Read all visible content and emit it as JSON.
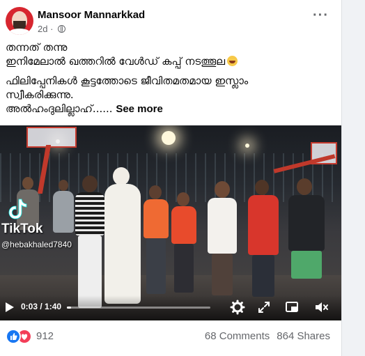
{
  "post": {
    "author": "Mansoor Mannarkkad",
    "time": "2d",
    "privacy_icon": "globe-icon",
    "menu_icon": "more-options-icon",
    "text_lines": [
      "തന്നത് തന്നു",
      "ഇനിമേലാൽ ഖത്തറിൽ വേൾഡ് കപ്പ് നടത്തൂല"
    ],
    "text_lines_2": [
      "ഫിലിപ്പേനികൾ കൂട്ടത്തോടെ ജീവിതമതമായ ഇസ്ലാം",
      "സ്വീകരിക്കുന്നു.",
      "അൽഹംദുലില്ലാഹ്......"
    ],
    "see_more": "See more"
  },
  "video": {
    "watermark_brand": "TikTok",
    "watermark_user": "@hebakhaled7840",
    "current_time": "0:03 / 1:40",
    "progress": 0.03,
    "icons": [
      "play-icon",
      "settings-icon",
      "fullscreen-icon",
      "picture-in-picture-icon",
      "volume-icon"
    ]
  },
  "footer": {
    "reaction_count": "912",
    "comments": "68 Comments",
    "shares": "864 Shares",
    "colors": {
      "like": "#1877f2",
      "love": "#f33e58"
    }
  }
}
